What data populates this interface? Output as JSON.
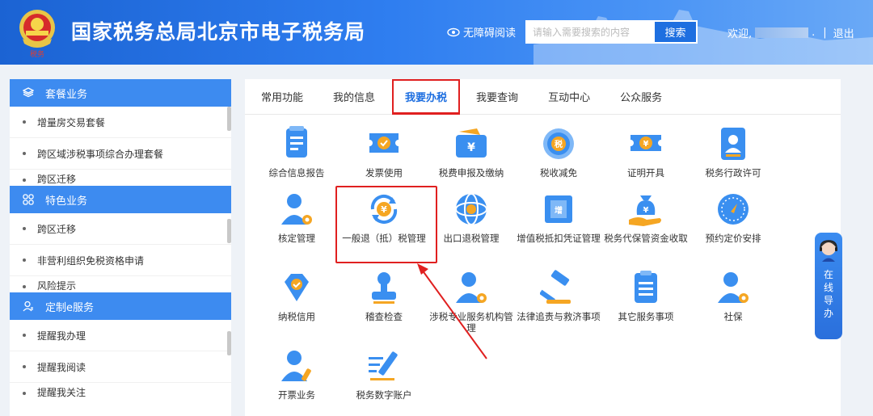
{
  "header": {
    "title": "国家税务总局北京市电子税务局",
    "accessibility": "无障碍阅读",
    "search_placeholder": "请输入需要搜索的内容",
    "search_button": "搜索",
    "welcome": "欢迎,",
    "welcome_suffix": ".",
    "separator": "|",
    "logout": "退出"
  },
  "sidebar": {
    "sections": [
      {
        "title": "套餐业务",
        "icon": "package-icon",
        "items": [
          "增量房交易套餐",
          "跨区域涉税事项综合办理套餐",
          "跨区迁移"
        ]
      },
      {
        "title": "特色业务",
        "icon": "grid-icon",
        "items": [
          "跨区迁移",
          "非营利组织免税资格申请",
          "风险提示"
        ]
      },
      {
        "title": "定制e服务",
        "icon": "user-icon",
        "items": [
          "提醒我办理",
          "提醒我阅读",
          "提醒我关注"
        ]
      }
    ]
  },
  "tabs": [
    "常用功能",
    "我的信息",
    "我要办税",
    "我要查询",
    "互动中心",
    "公众服务"
  ],
  "active_tab": "我要办税",
  "services": [
    {
      "label": "综合信息报告",
      "icon": "document-icon"
    },
    {
      "label": "发票使用",
      "icon": "invoice-icon"
    },
    {
      "label": "税费申报及缴纳",
      "icon": "wallet-icon"
    },
    {
      "label": "税收减免",
      "icon": "tax-reduction-icon"
    },
    {
      "label": "证明开具",
      "icon": "certificate-icon"
    },
    {
      "label": "税务行政许可",
      "icon": "license-icon"
    },
    {
      "label": "核定管理",
      "icon": "user-gear-icon"
    },
    {
      "label": "一般退（抵）税管理",
      "icon": "refund-cycle-icon"
    },
    {
      "label": "出口退税管理",
      "icon": "globe-icon"
    },
    {
      "label": "增值税抵扣凭证管理",
      "icon": "vat-ticket-icon"
    },
    {
      "label": "税务代保管资金收取",
      "icon": "money-bag-icon"
    },
    {
      "label": "预约定价安排",
      "icon": "compass-icon"
    },
    {
      "label": "纳税信用",
      "icon": "diamond-icon"
    },
    {
      "label": "稽查检查",
      "icon": "stamp-icon"
    },
    {
      "label": "涉税专业服务机构管理",
      "icon": "user-gear-icon"
    },
    {
      "label": "法律追责与救济事项",
      "icon": "gavel-icon"
    },
    {
      "label": "其它服务事项",
      "icon": "clipboard-icon"
    },
    {
      "label": "社保",
      "icon": "user-gear-icon"
    },
    {
      "label": "开票业务",
      "icon": "user-pen-icon"
    },
    {
      "label": "税务数字账户",
      "icon": "pen-list-icon"
    }
  ],
  "online_guide": [
    "在",
    "线",
    "导",
    "办"
  ],
  "colors": {
    "brand": "#2f7ef0",
    "highlight": "#e02020",
    "icon_blue": "#3a8ff0",
    "icon_orange": "#f5a623"
  }
}
